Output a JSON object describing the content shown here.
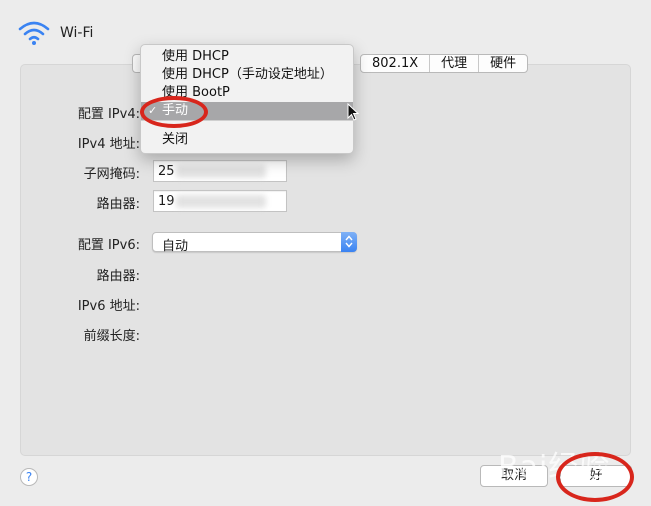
{
  "window": {
    "title": "Wi-Fi"
  },
  "tabs": [
    "802.1X",
    "代理",
    "硬件"
  ],
  "form": {
    "ipv4_config_label": "配置 IPv4:",
    "ipv4_address_label": "IPv4 地址:",
    "subnet_label": "子网掩码:",
    "subnet_value": "25",
    "router_label": "路由器:",
    "router_value": "19",
    "ipv6_config_label": "配置 IPv6:",
    "ipv6_config_value": "自动",
    "ipv6_router_label": "路由器:",
    "ipv6_address_label": "IPv6 地址:",
    "prefix_label": "前缀长度:"
  },
  "dropdown_menu": {
    "items": [
      "使用 DHCP",
      "使用 DHCP（手动设定地址）",
      "使用 BootP",
      "手动",
      "关闭"
    ],
    "selected": "手动",
    "check_mark": "✓"
  },
  "footer": {
    "help": "?",
    "cancel": "取消",
    "ok": "好"
  },
  "watermark": "Bai经验",
  "colors": {
    "highlight": "#a7a7a9",
    "annotation": "#d8261c",
    "accent": "#3a83f2"
  }
}
